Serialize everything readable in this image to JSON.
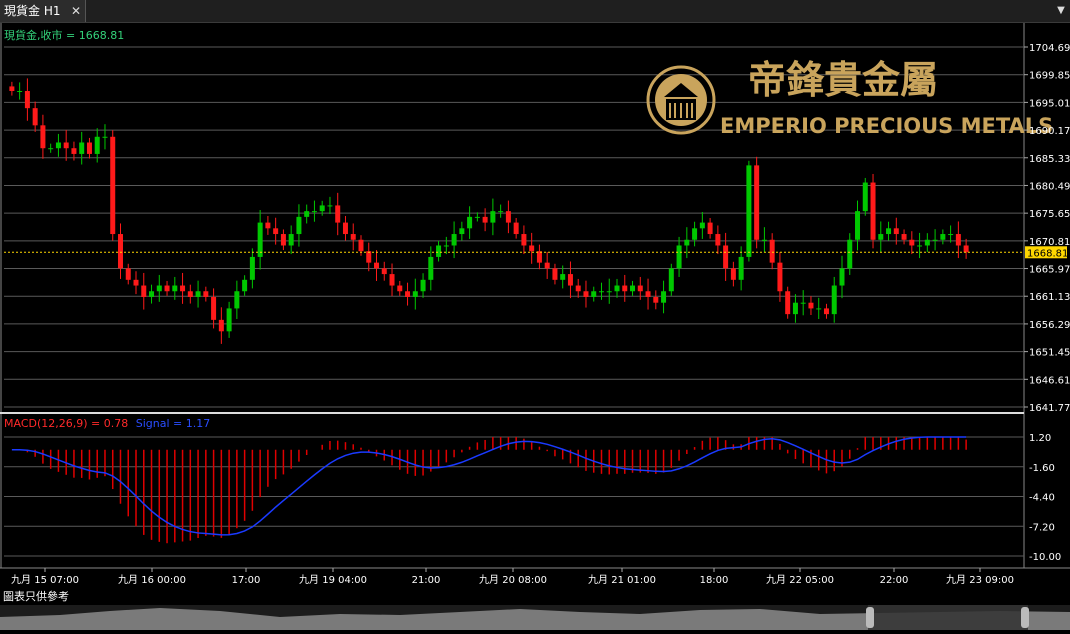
{
  "window": {
    "tab_label": "現貨金 H1",
    "close_glyph": "✕",
    "menu_glyph": "▼"
  },
  "colors": {
    "background": "#000000",
    "grid": "#5a5a5a",
    "up_candle": "#00c800",
    "down_candle": "#ff1a1a",
    "price_line": "#ffd700",
    "macd_hist": "#e00000",
    "signal_line": "#1a3aff",
    "gold_logo": "#c9a45c"
  },
  "logo": {
    "chinese": "帝鋒貴金屬",
    "english": "EMPERIO PRECIOUS METALS",
    "emblem": "emblem-icon"
  },
  "chart_data": [
    {
      "type": "candlestick",
      "title": "現貨金,收市 = 1668.81",
      "symbol": "現貨金",
      "timeframe": "H1",
      "last_price": "1668.81",
      "y_tick_labels": [
        "1704.69",
        "1699.85",
        "1695.01",
        "1690.17",
        "1685.33",
        "1680.49",
        "1675.65",
        "1670.81",
        "1665.97",
        "1661.13",
        "1656.29",
        "1651.45",
        "1646.61",
        "1641.77"
      ],
      "ylim": [
        1641.77,
        1704.69
      ],
      "x_tick_labels": [
        "九月 15 07:00",
        "九月 16 00:00",
        "17:00",
        "九月 19 04:00",
        "21:00",
        "九月 20 08:00",
        "九月 21 01:00",
        "18:00",
        "九月 22 05:00",
        "22:00",
        "九月 23 09:00"
      ],
      "close_path": [
        1697,
        1697,
        1694,
        1691,
        1687,
        1687,
        1688,
        1687,
        1686,
        1688,
        1686,
        1689,
        1689,
        1672,
        1666,
        1664,
        1663,
        1661,
        1662,
        1663,
        1662,
        1663,
        1662,
        1661,
        1662,
        1661,
        1657,
        1655,
        1659,
        1662,
        1664,
        1668,
        1674,
        1673,
        1672,
        1670,
        1672,
        1675,
        1676,
        1676,
        1677,
        1677,
        1674,
        1672,
        1671,
        1669,
        1667,
        1666,
        1665,
        1663,
        1662,
        1661,
        1662,
        1664,
        1668,
        1670,
        1670,
        1672,
        1673,
        1675,
        1675,
        1674,
        1676,
        1676,
        1674,
        1672,
        1670,
        1669,
        1667,
        1666,
        1664,
        1665,
        1663,
        1662,
        1661,
        1662,
        1662,
        1662,
        1663,
        1662,
        1663,
        1662,
        1661,
        1660,
        1662,
        1666,
        1670,
        1671,
        1673,
        1674,
        1672,
        1670,
        1666,
        1664,
        1668,
        1684,
        1671,
        1671,
        1667,
        1662,
        1658,
        1660,
        1660,
        1659,
        1659,
        1658,
        1663,
        1666,
        1671,
        1676,
        1681,
        1671,
        1672,
        1673,
        1672,
        1671,
        1670,
        1670,
        1671,
        1671,
        1672,
        1672,
        1670,
        1668.81
      ],
      "macd_subtitle": "MACD(12,26,9) = 0.78",
      "signal_subtitle": "Signal = 1.17",
      "macd_tick_labels": [
        "1.20",
        "-1.60",
        "-4.40",
        "-7.20",
        "-10.00"
      ],
      "macd_ylim": [
        -10.0,
        1.2
      ],
      "macd_current": 0.78,
      "signal_current": 1.17
    }
  ],
  "footer": {
    "disclaimer": "圖表只供參考"
  }
}
